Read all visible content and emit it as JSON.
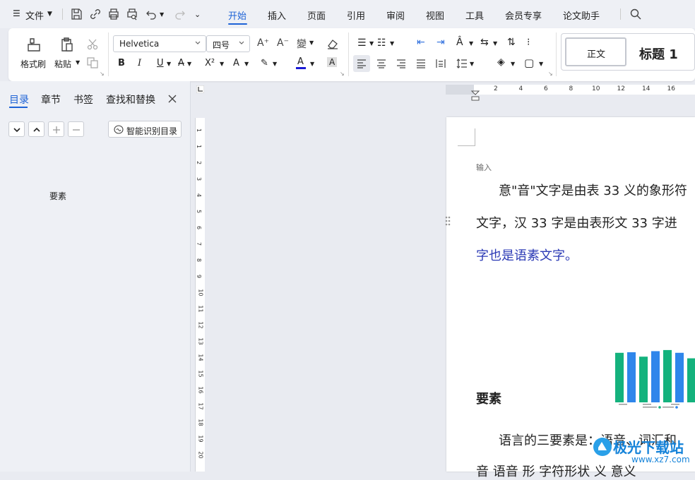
{
  "menubar": {
    "file_label": "文件",
    "tabs": [
      "开始",
      "插入",
      "页面",
      "引用",
      "审阅",
      "视图",
      "工具",
      "会员专享",
      "论文助手"
    ]
  },
  "ribbon": {
    "format_painter": "格式刷",
    "paste": "粘贴",
    "font_name": "Helvetica",
    "font_size": "四号",
    "styles": {
      "normal": "正文",
      "heading1": "标题 1"
    }
  },
  "sidebar": {
    "tabs": [
      "目录",
      "章节",
      "书签",
      "查找和替换"
    ],
    "smart_toc": "智能识别目录",
    "toc_items": [
      "要素"
    ]
  },
  "hruler": {
    "ticks": [
      "2",
      "4",
      "6",
      "8",
      "10",
      "12",
      "14",
      "16"
    ]
  },
  "vruler": {
    "ticks": [
      "1",
      "1",
      "2",
      "3",
      "4",
      "5",
      "6",
      "7",
      "8",
      "9",
      "10",
      "11",
      "12",
      "13",
      "14",
      "15",
      "16",
      "17",
      "18",
      "19",
      "20"
    ]
  },
  "document": {
    "input_label": "输入",
    "para1_line1": "意\"音\"文字是由表 33 义的象形符",
    "para1_line2": "文字，汉 33 字是由表形文 33 字进",
    "para1_line3": "字也是语素文字。",
    "heading": "要素",
    "para2_line1": "语言的三要素是：语音、词汇和",
    "para2_line2": "音 语音 形 字符形状 义 意义"
  },
  "chart": {
    "values": [
      0.9,
      0.91,
      0.83,
      0.93,
      0.95,
      0.9,
      0.8
    ],
    "colors": [
      "#14b27d",
      "#2f86eb"
    ]
  },
  "watermark": "极光下载站",
  "watermark_url": "www.xz7.com",
  "colors": {
    "accent": "#1e63d6",
    "link_text": "#2b3ab5"
  }
}
